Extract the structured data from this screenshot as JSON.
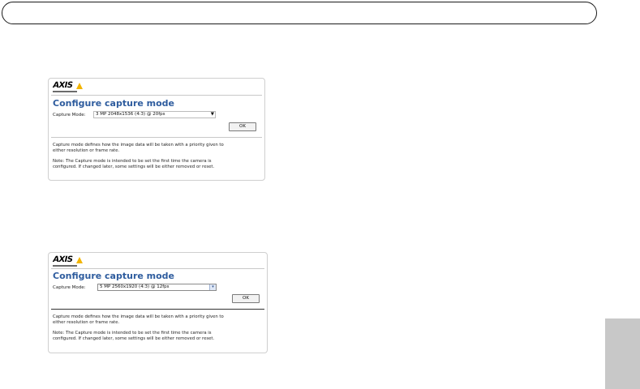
{
  "panels": [
    {
      "logo": "AXIS",
      "title": "Configure capture mode",
      "capture_label": "Capture Mode:",
      "capture_value": "3 MP 2048x1536 (4:3) @ 20fps",
      "ok_label": "OK",
      "desc_line1": "Capture mode defines how the image data will be taken with a priority given to",
      "desc_line2": "either resolution or frame rate.",
      "note_line1": "Note: The Capture mode is intended to be set the first time the camera is",
      "note_line2": "configured. If changed later, some settings will be either removed or reset."
    },
    {
      "logo": "AXIS",
      "title": "Configure capture mode",
      "capture_label": "Capture Mode:",
      "capture_value": "5 MP 2560x1920 (4:3) @ 12fps",
      "ok_label": "OK",
      "desc_line1": "Capture mode defines how the image data will be taken with a priority given to",
      "desc_line2": "either resolution or frame rate.",
      "note_line1": "Note: The Capture mode is intended to be set the first time the camera is",
      "note_line2": "configured. If changed later, some settings will be either removed or reset."
    }
  ],
  "icons": {
    "select_arrow_1": "dropdown-arrow-icon",
    "select_arrow_2": "dropdown-arrow-icon"
  }
}
